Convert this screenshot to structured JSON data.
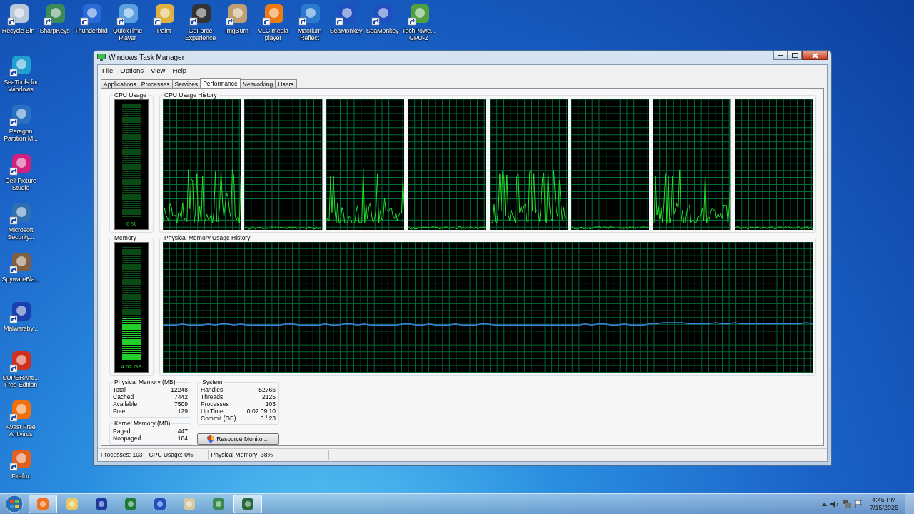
{
  "desktop_top": [
    {
      "label": "Recycle Bin"
    },
    {
      "label": "SharpKeys"
    },
    {
      "label": "Thunderbird"
    },
    {
      "label": "QuickTime Player"
    },
    {
      "label": "Paint"
    },
    {
      "label": "GeForce Experience"
    },
    {
      "label": "ImgBurn"
    },
    {
      "label": "VLC media player"
    },
    {
      "label": "Macrium Reflect"
    },
    {
      "label": "SeaMonkey"
    },
    {
      "label": "SeaMonkey"
    },
    {
      "label": "TechPowe... GPU-Z"
    }
  ],
  "desktop_left": [
    {
      "label": "SeaTools for Windows"
    },
    {
      "label": "Paragon Partition M..."
    },
    {
      "label": "Dell Picture Studio"
    },
    {
      "label": "Microsoft Security..."
    },
    {
      "label": "SpywareBla..."
    },
    {
      "label": "Malwareby..."
    },
    {
      "label": "SUPERAnti... Free Edition"
    },
    {
      "label": "Avast Free Antivirus"
    },
    {
      "label": "Firefox"
    }
  ],
  "window": {
    "title": "Windows Task Manager",
    "menu": [
      "File",
      "Options",
      "View",
      "Help"
    ],
    "tabs": [
      {
        "label": "Applications",
        "selected": false
      },
      {
        "label": "Processes",
        "selected": false
      },
      {
        "label": "Services",
        "selected": false
      },
      {
        "label": "Performance",
        "selected": true
      },
      {
        "label": "Networking",
        "selected": false
      },
      {
        "label": "Users",
        "selected": false
      }
    ],
    "cpu_usage": {
      "title": "CPU Usage",
      "reading": "0 %",
      "level": 0
    },
    "cpu_history": {
      "title": "CPU Usage History",
      "graphs": [
        {
          "kind": "active"
        },
        {
          "kind": "idle"
        },
        {
          "kind": "active"
        },
        {
          "kind": "idle"
        },
        {
          "kind": "active"
        },
        {
          "kind": "idle"
        },
        {
          "kind": "active"
        },
        {
          "kind": "idle"
        }
      ]
    },
    "memory": {
      "title": "Memory",
      "reading": "4.62 GB",
      "level": 0.38
    },
    "memory_history": {
      "title": "Physical Memory Usage History"
    },
    "physical_memory": {
      "title": "Physical Memory (MB)",
      "rows": [
        {
          "label": "Total",
          "value": "12248"
        },
        {
          "label": "Cached",
          "value": "7442"
        },
        {
          "label": "Available",
          "value": "7509"
        },
        {
          "label": "Free",
          "value": "129"
        }
      ]
    },
    "kernel_memory": {
      "title": "Kernel Memory (MB)",
      "rows": [
        {
          "label": "Paged",
          "value": "447"
        },
        {
          "label": "Nonpaged",
          "value": "164"
        }
      ]
    },
    "system": {
      "title": "System",
      "rows": [
        {
          "label": "Handles",
          "value": "52766"
        },
        {
          "label": "Threads",
          "value": "2125"
        },
        {
          "label": "Processes",
          "value": "103"
        },
        {
          "label": "Up Time",
          "value": "0:02:09:10"
        },
        {
          "label": "Commit (GB)",
          "value": "5 / 23"
        }
      ]
    },
    "resource_monitor_button": "Resource Monitor...",
    "status_bar": [
      "Processes: 103",
      "CPU Usage: 0%",
      "Physical Memory: 38%"
    ]
  },
  "taskbar": {
    "apps": [
      {
        "running": true
      },
      {
        "running": false
      },
      {
        "running": false
      },
      {
        "running": false
      },
      {
        "running": false
      },
      {
        "running": false
      },
      {
        "running": false
      },
      {
        "running": true
      }
    ],
    "clock": {
      "time": "4:45 PM",
      "date": "7/15/2025"
    }
  }
}
